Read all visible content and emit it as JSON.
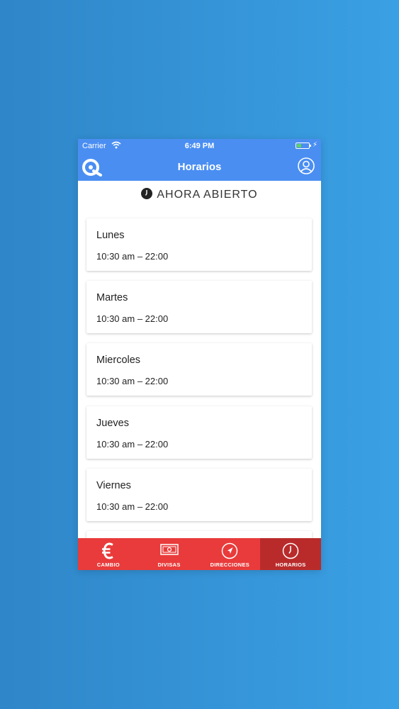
{
  "status_bar": {
    "carrier": "Carrier",
    "time": "6:49 PM"
  },
  "header": {
    "title": "Horarios"
  },
  "open_status": "AHORA ABIERTO",
  "schedule": [
    {
      "day": "Lunes",
      "hours": "10:30 am – 22:00"
    },
    {
      "day": "Martes",
      "hours": "10:30 am – 22:00"
    },
    {
      "day": "Miercoles",
      "hours": "10:30 am – 22:00"
    },
    {
      "day": "Jueves",
      "hours": "10:30 am – 22:00"
    },
    {
      "day": "Viernes",
      "hours": "10:30 am – 22:00"
    },
    {
      "day": "",
      "hours": ""
    }
  ],
  "tabs": [
    {
      "label": "CAMBIO",
      "icon": "euro-icon",
      "active": false
    },
    {
      "label": "DIVISAS",
      "icon": "banknote-icon",
      "active": false
    },
    {
      "label": "DIRECCIONES",
      "icon": "navigation-icon",
      "active": false
    },
    {
      "label": "HORARIOS",
      "icon": "clock-icon",
      "active": true
    }
  ],
  "colors": {
    "nav_blue": "#4a8ef2",
    "tab_red": "#e93b3b",
    "tab_active": "#b92b2b",
    "background_left": "#2f86c8",
    "background_right": "#3aa0e4"
  }
}
